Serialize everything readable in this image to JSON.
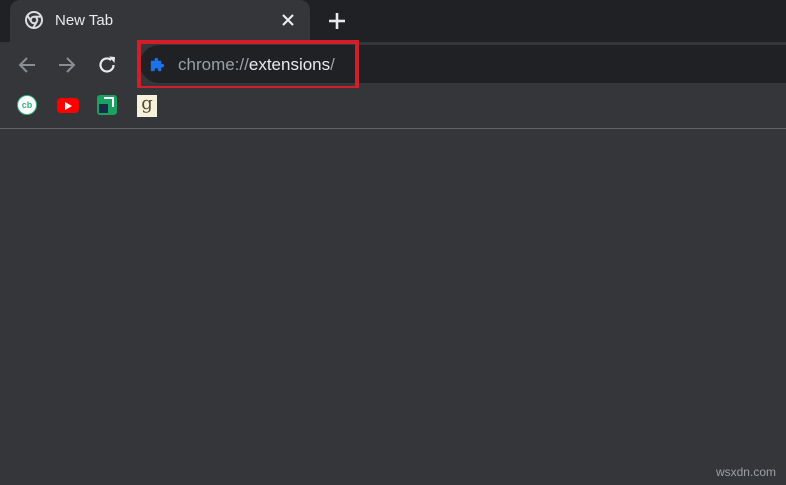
{
  "tab": {
    "title": "New Tab",
    "favicon": "chrome-icon"
  },
  "new_tab_button": {
    "icon": "plus-icon"
  },
  "toolbar": {
    "back_icon": "back-arrow-icon",
    "forward_icon": "forward-arrow-icon",
    "reload_icon": "reload-icon"
  },
  "omnibox": {
    "icon": "puzzle-extension-icon",
    "url_scheme": "chrome://",
    "url_host": "extensions",
    "url_trailing": "/"
  },
  "bookmarks": [
    {
      "name": "cb",
      "icon": "cb-icon"
    },
    {
      "name": "YouTube",
      "icon": "youtube-icon"
    },
    {
      "name": "extension",
      "icon": "green-extension-icon"
    },
    {
      "name": "g",
      "icon": "g-icon"
    }
  ],
  "watermark": "wsxdn.com",
  "colors": {
    "tabstrip": "#202124",
    "toolbar": "#35363a",
    "omnibox": "#202124",
    "highlight": "#d01f29",
    "omnibox_icon": "#1a73e8"
  }
}
